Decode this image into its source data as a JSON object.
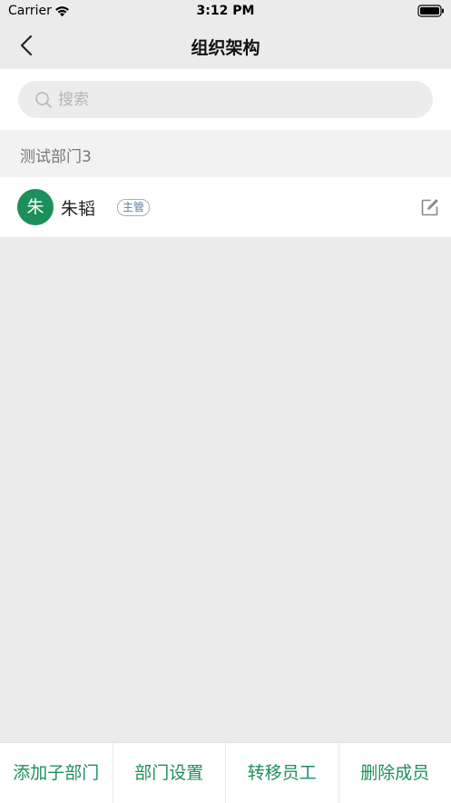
{
  "status_bar": {
    "carrier": "Carrier",
    "time": "3:12 PM"
  },
  "nav": {
    "title": "组织架构",
    "back_icon": "chevron-left-icon"
  },
  "search": {
    "placeholder": "搜索",
    "value": "",
    "icon": "search-icon"
  },
  "department": {
    "name": "测试部门3"
  },
  "members": [
    {
      "avatar_text": "朱",
      "name": "朱韬",
      "role_badge": "主管",
      "edit_icon": "edit-icon"
    }
  ],
  "bottom_actions": [
    {
      "label": "添加子部门"
    },
    {
      "label": "部门设置"
    },
    {
      "label": "转移员工"
    },
    {
      "label": "删除成员"
    }
  ],
  "colors": {
    "accent": "#1d8f5a",
    "background": "#ebebeb",
    "badge_border": "#9bb3c9",
    "badge_text": "#5f7f9e"
  }
}
